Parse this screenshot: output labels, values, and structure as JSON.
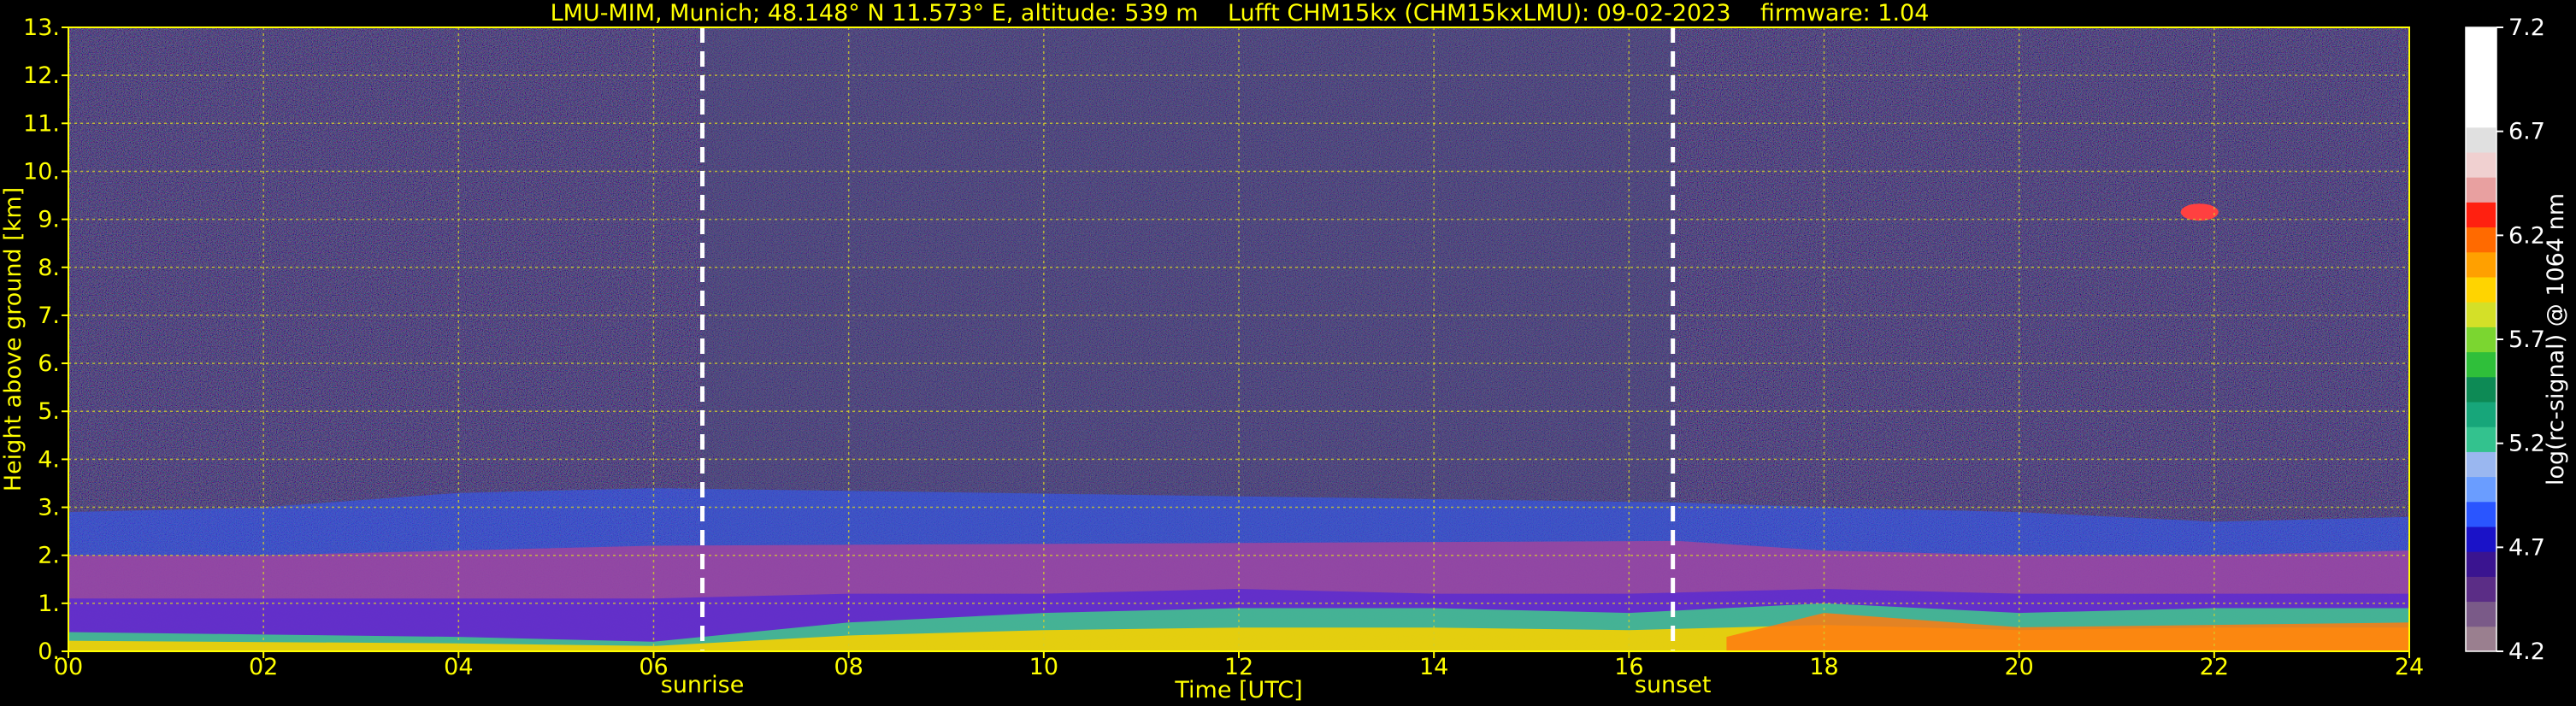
{
  "chart_data": {
    "type": "heatmap",
    "title": "LMU-MIM, Munich; 48.148° N 11.573° E, altitude: 539 m    Lufft CHM15kx (CHM15kxLMU): 09-02-2023    firmware: 1.04",
    "xlabel": "Time [UTC]",
    "ylabel": "Height above ground [km]",
    "xlim": [
      0,
      24
    ],
    "ylim": [
      0,
      13
    ],
    "x_ticks": [
      "00",
      "02",
      "04",
      "06",
      "08",
      "10",
      "12",
      "14",
      "16",
      "18",
      "20",
      "22",
      "24"
    ],
    "y_ticks": [
      "0.",
      "1.",
      "2.",
      "3.",
      "4.",
      "5.",
      "6.",
      "7.",
      "8.",
      "9.",
      "10.",
      "11.",
      "12.",
      "13."
    ],
    "grid": true,
    "annotations": [
      {
        "label": "sunrise",
        "x": 6.5
      },
      {
        "label": "sunset",
        "x": 16.45
      }
    ],
    "colorbar": {
      "label": "log(rc-signal) @ 1064 nm",
      "range": [
        4.2,
        7.2
      ],
      "ticks": [
        "4.2",
        "4.7",
        "5.2",
        "5.7",
        "6.2",
        "6.7",
        "7.2"
      ]
    },
    "layers": [
      {
        "feature": "surface aerosol (yellow/orange/green)",
        "x": [
          0,
          2,
          4,
          6,
          8,
          10,
          12,
          14,
          16,
          18,
          20,
          22,
          24
        ],
        "top_km": [
          0.4,
          0.35,
          0.3,
          0.2,
          0.6,
          0.8,
          0.9,
          0.9,
          0.8,
          1.0,
          0.8,
          0.9,
          0.9
        ]
      },
      {
        "feature": "boundary layer top (blue/purple)",
        "x": [
          0,
          2,
          4,
          6,
          8,
          10,
          12,
          14,
          16,
          18,
          20,
          22,
          24
        ],
        "top_km": [
          1.1,
          1.1,
          1.1,
          1.1,
          1.2,
          1.2,
          1.3,
          1.2,
          1.2,
          1.3,
          1.2,
          1.2,
          1.2
        ]
      },
      {
        "feature": "residual layer (magenta)",
        "x": [
          0,
          2,
          4,
          6,
          16.5,
          18,
          20,
          22,
          24
        ],
        "top_km": [
          2.0,
          2.0,
          2.1,
          2.2,
          2.3,
          2.1,
          2.0,
          2.0,
          2.1
        ]
      },
      {
        "feature": "elevated aerosol layer (blue)",
        "x": [
          0,
          2,
          4,
          6,
          16.5,
          18,
          20,
          22,
          24
        ],
        "top_km": [
          2.9,
          3.0,
          3.3,
          3.4,
          3.1,
          3.0,
          2.9,
          2.7,
          2.8
        ]
      },
      {
        "feature": "cirrus fragment",
        "x": [
          21.7,
          22.0
        ],
        "top_km": [
          9.3,
          9.0
        ]
      }
    ]
  }
}
